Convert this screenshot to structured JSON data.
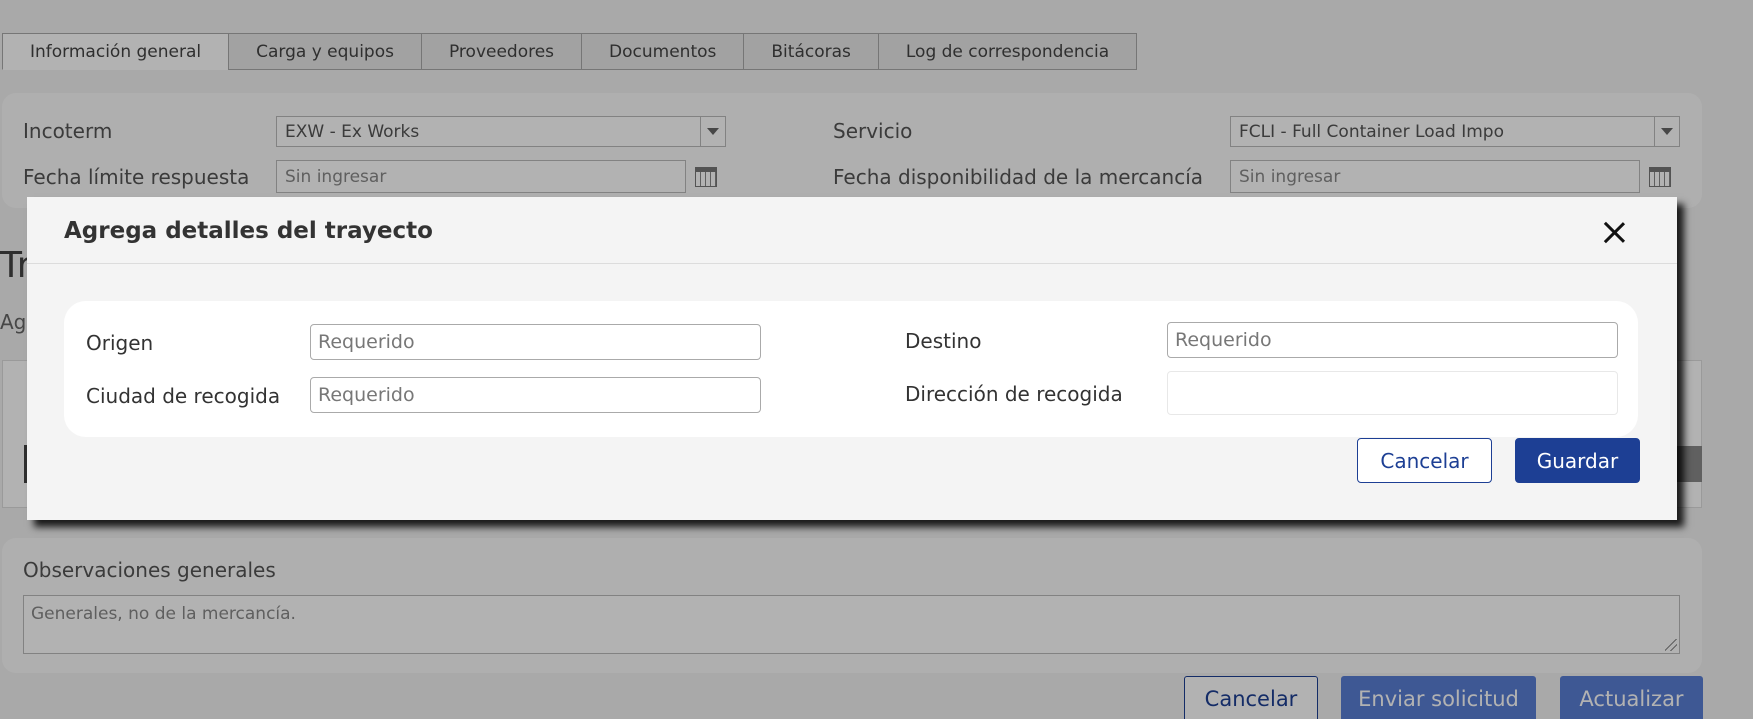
{
  "tabs": [
    {
      "label": "Información general",
      "active": true
    },
    {
      "label": "Carga y equipos"
    },
    {
      "label": "Proveedores"
    },
    {
      "label": "Documentos"
    },
    {
      "label": "Bitácoras"
    },
    {
      "label": "Log de correspondencia"
    }
  ],
  "form": {
    "incoterm_label": "Incoterm",
    "incoterm_value": "EXW - Ex Works",
    "servicio_label": "Servicio",
    "servicio_value": "FCLI - Full Container Load Impo",
    "fecha_limite_label": "Fecha límite respuesta",
    "fecha_limite_placeholder": "Sin ingresar",
    "fecha_disp_label": "Fecha disponibilidad de la mercancía",
    "fecha_disp_placeholder": "Sin ingresar"
  },
  "background": {
    "section_heading_partial": "Tr",
    "section_sub_partial": "Ag"
  },
  "observaciones": {
    "label": "Observaciones generales",
    "placeholder": "Generales, no de la mercancía."
  },
  "footer": {
    "cancel_label": "Cancelar",
    "send_label": "Enviar solicitud",
    "update_label": "Actualizar"
  },
  "modal": {
    "title": "Agrega detalles del trayecto",
    "origen_label": "Origen",
    "origen_placeholder": "Requerido",
    "destino_label": "Destino",
    "destino_placeholder": "Requerido",
    "ciudad_label": "Ciudad de recogida",
    "ciudad_placeholder": "Requerido",
    "direccion_label": "Dirección de recogida",
    "direccion_value": "",
    "cancel_label": "Cancelar",
    "save_label": "Guardar"
  },
  "colors": {
    "primary": "#1d3f94",
    "overlay": "rgba(0,0,0,0.3)"
  }
}
